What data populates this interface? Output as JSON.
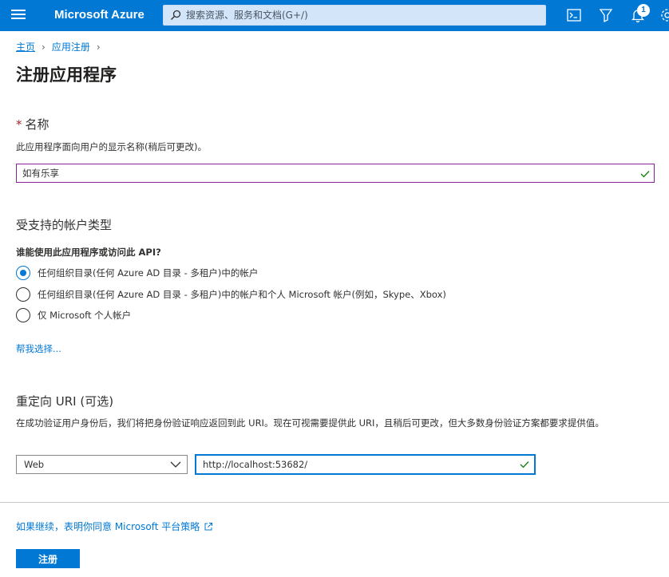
{
  "topbar": {
    "brand": "Microsoft Azure",
    "search_placeholder": "搜索资源、服务和文档(G+/)",
    "notification_count": "1",
    "bg_color": "#0078d4"
  },
  "breadcrumb": {
    "home": "主页",
    "app_reg": "应用注册"
  },
  "page": {
    "title": "注册应用程序"
  },
  "name_section": {
    "required_mark": "*",
    "title": "名称",
    "description": "此应用程序面向用户的显示名称(稍后可更改)。",
    "value": "如有乐享"
  },
  "account_section": {
    "title": "受支持的帐户类型",
    "question": "谁能使用此应用程序或访问此 API?",
    "options": [
      "任何组织目录(任何 Azure AD 目录 - 多租户)中的帐户",
      "任何组织目录(任何 Azure AD 目录 - 多租户)中的帐户和个人 Microsoft 帐户(例如，Skype、Xbox)",
      "仅 Microsoft 个人帐户"
    ],
    "selected_index": 0,
    "help_link": "帮我选择..."
  },
  "redirect_section": {
    "title": "重定向 URI (可选)",
    "description": "在成功验证用户身份后，我们将把身份验证响应返回到此 URI。现在可视需要提供此 URI，且稍后可更改，但大多数身份验证方案都要求提供值。",
    "platform": "Web",
    "uri": "http://localhost:53682/"
  },
  "footer": {
    "policy_link": "如果继续，表明你同意 Microsoft 平台策略",
    "register_label": "注册"
  }
}
